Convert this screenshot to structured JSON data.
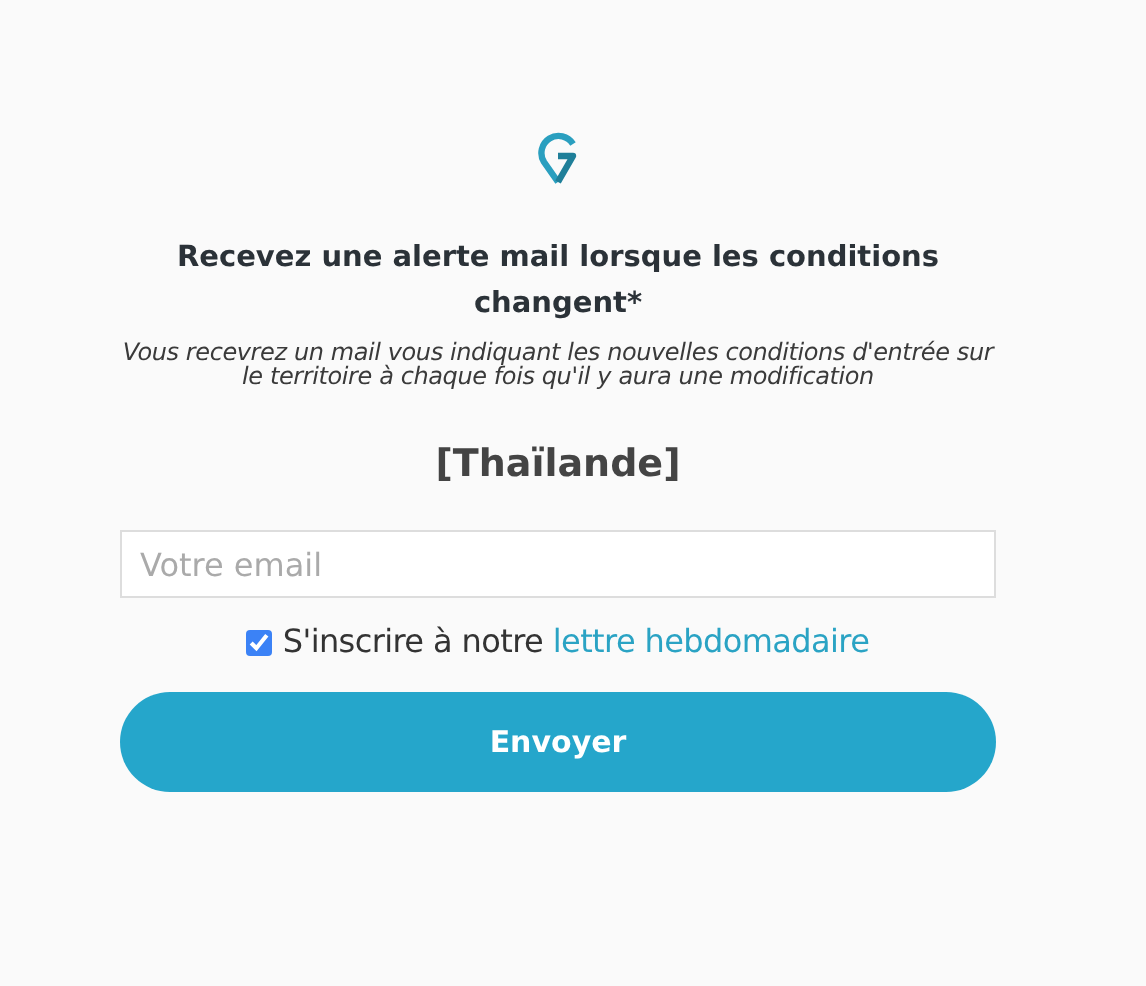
{
  "heading": "Recevez une alerte mail lorsque les conditions changent*",
  "description": "Vous recevrez un mail vous indiquant les nouvelles conditions d'entrée sur le territoire à chaque fois qu'il y aura une modification",
  "country": "[Thaïlande]",
  "email": {
    "placeholder": "Votre email"
  },
  "newsletter": {
    "checked": true,
    "label": "S'inscrire à notre ",
    "link": "lettre hebdomadaire"
  },
  "submit": "Envoyer"
}
